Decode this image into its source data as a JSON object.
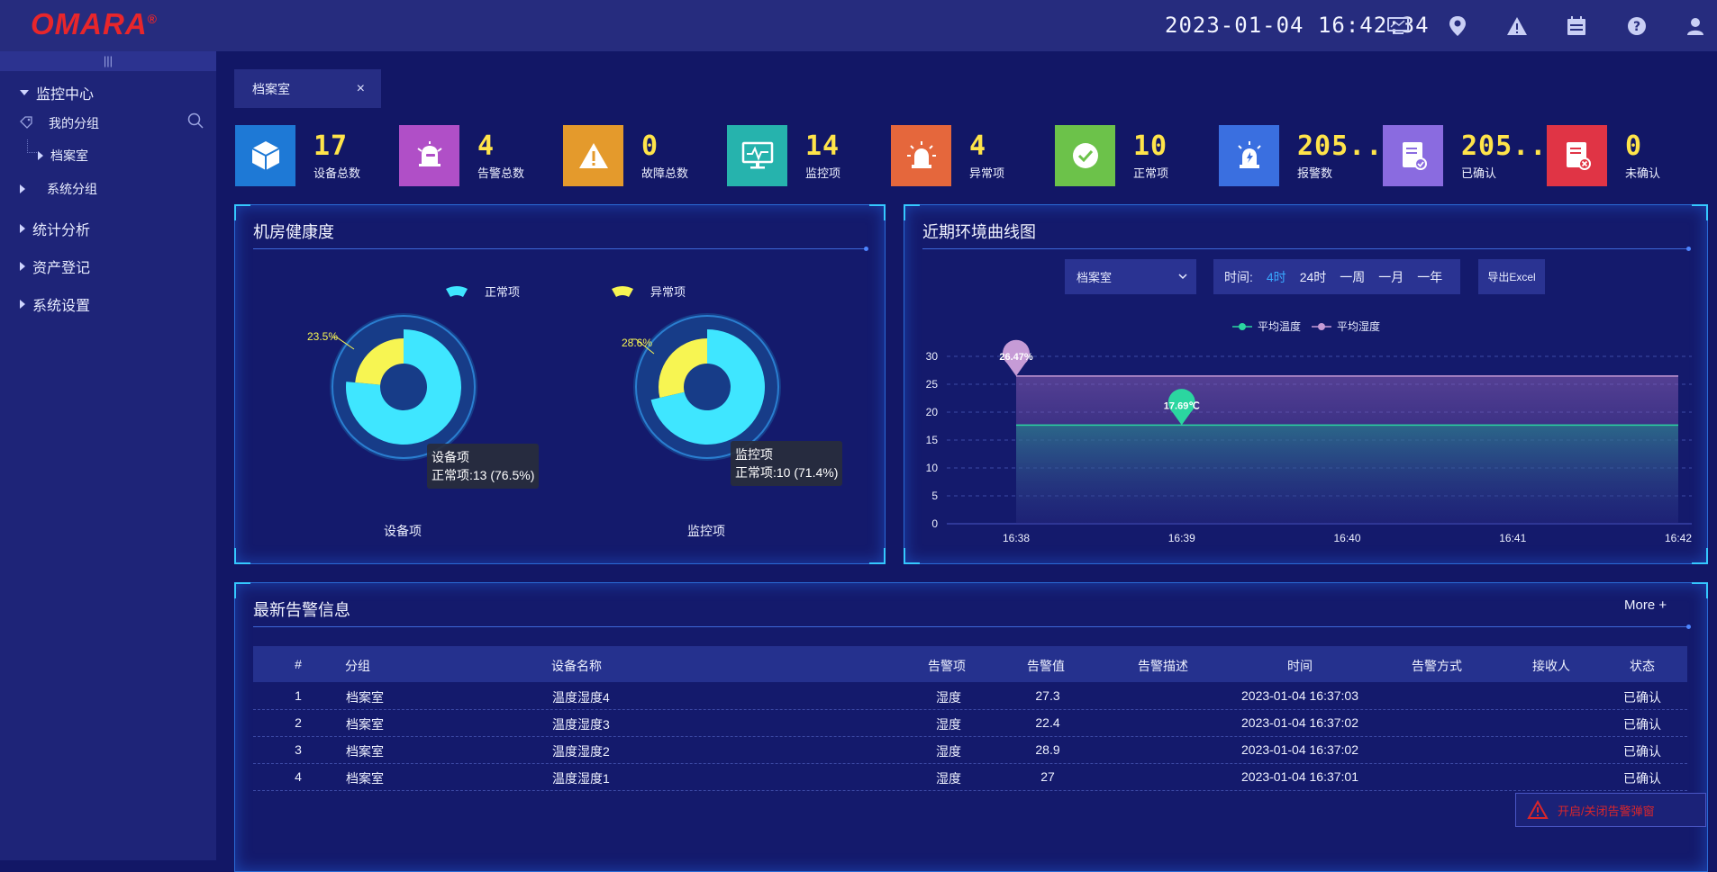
{
  "app": {
    "logo_text": "OMARA",
    "logo_mark": "®",
    "datetime": "2023-01-04 16:42:34"
  },
  "topbar_icons": [
    "monitor-icon",
    "location-pin-icon",
    "warning-icon",
    "calendar-icon",
    "help-icon",
    "user-icon"
  ],
  "sidebar": {
    "collapse": "|||",
    "monitor_center": "监控中心",
    "my_group": "我的分组",
    "archive_room": "档案室",
    "system_group": "系统分组",
    "stats": "统计分析",
    "assets": "资产登记",
    "settings": "系统设置"
  },
  "tab": {
    "label": "档案室",
    "close": "×"
  },
  "stats": [
    {
      "value": "17",
      "label": "设备总数",
      "color": "#1e79d6",
      "icon": "cube-icon"
    },
    {
      "value": "4",
      "label": "告警总数",
      "color": "#b04fc7",
      "icon": "alarm-bell-icon"
    },
    {
      "value": "0",
      "label": "故障总数",
      "color": "#e49a2c",
      "icon": "warning-icon"
    },
    {
      "value": "14",
      "label": "监控项",
      "color": "#26b3ad",
      "icon": "monitor-chart-icon"
    },
    {
      "value": "4",
      "label": "异常项",
      "color": "#e5673c",
      "icon": "siren-icon"
    },
    {
      "value": "10",
      "label": "正常项",
      "color": "#6cc24a",
      "icon": "check-icon"
    },
    {
      "value": "205...",
      "label": "报警数",
      "color": "#3a6fe0",
      "icon": "alarm-light-icon"
    },
    {
      "value": "205...",
      "label": "已确认",
      "color": "#8a6be0",
      "icon": "confirmed-doc-icon"
    },
    {
      "value": "0",
      "label": "未确认",
      "color": "#e03445",
      "icon": "unconfirmed-doc-icon"
    }
  ],
  "health": {
    "title": "机房健康度",
    "legend_normal": "正常项",
    "legend_abnormal": "异常项",
    "color_normal": "#3fe6ff",
    "color_abnormal": "#f7f552",
    "devices": {
      "label": "设备项",
      "abnormal_pct": "23.5%",
      "normal": 13,
      "abnormal": 4,
      "tooltip_title": "设备项",
      "tooltip_value": "正常项:13 (76.5%)"
    },
    "monitors": {
      "label": "监控项",
      "abnormal_pct": "28.6%",
      "normal": 10,
      "abnormal": 4,
      "tooltip_title": "监控项",
      "tooltip_value": "正常项:10 (71.4%)"
    }
  },
  "env": {
    "title": "近期环境曲线图",
    "select_value": "档案室",
    "time_label": "时间:",
    "time_options": [
      "4时",
      "24时",
      "一周",
      "一月",
      "一年"
    ],
    "export_label": "导出Excel"
  },
  "chart_data": {
    "type": "area",
    "x": [
      "16:38",
      "16:39",
      "16:40",
      "16:41",
      "16:42"
    ],
    "ylim": [
      0,
      30
    ],
    "y_ticks": [
      "0",
      "5",
      "10",
      "15",
      "20",
      "25",
      "30"
    ],
    "grid": true,
    "legend_position": "top-center",
    "series": [
      {
        "name": "平均温度",
        "color": "#2bd6a0",
        "values": [
          17.69,
          17.69,
          17.69,
          17.69,
          17.69
        ],
        "marker_label": "17.69℃"
      },
      {
        "name": "平均湿度",
        "color": "#c69bd6",
        "values": [
          26.47,
          26.47,
          26.47,
          26.47,
          26.47
        ],
        "marker_label": "26.47%"
      }
    ]
  },
  "alarms": {
    "title": "最新告警信息",
    "more": "More +",
    "columns": [
      "#",
      "分组",
      "设备名称",
      "告警项",
      "告警值",
      "告警描述",
      "时间",
      "告警方式",
      "接收人",
      "状态"
    ],
    "rows": [
      {
        "no": "1",
        "group": "档案室",
        "device": "温度湿度4",
        "item": "湿度",
        "value": "27.3",
        "desc": "",
        "time": "2023-01-04 16:37:03",
        "method": "",
        "receiver": "",
        "status": "已确认"
      },
      {
        "no": "2",
        "group": "档案室",
        "device": "温度湿度3",
        "item": "湿度",
        "value": "22.4",
        "desc": "",
        "time": "2023-01-04 16:37:02",
        "method": "",
        "receiver": "",
        "status": "已确认"
      },
      {
        "no": "3",
        "group": "档案室",
        "device": "温度湿度2",
        "item": "湿度",
        "value": "28.9",
        "desc": "",
        "time": "2023-01-04 16:37:02",
        "method": "",
        "receiver": "",
        "status": "已确认"
      },
      {
        "no": "4",
        "group": "档案室",
        "device": "温度湿度1",
        "item": "湿度",
        "value": "27",
        "desc": "",
        "time": "2023-01-04 16:37:01",
        "method": "",
        "receiver": "",
        "status": "已确认"
      }
    ],
    "popup_label": "开启/关闭告警弹窗"
  }
}
